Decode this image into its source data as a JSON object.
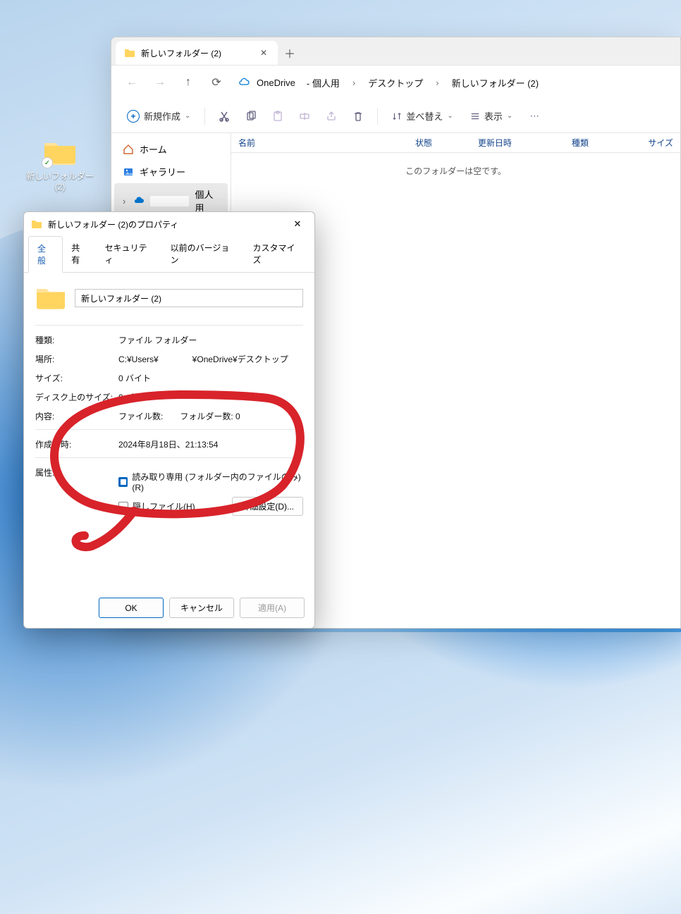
{
  "desktop": {
    "folder_label": "新しいフォルダー (2)"
  },
  "explorer": {
    "tab_title": "新しいフォルダー (2)",
    "breadcrumb": {
      "onedrive": "OneDrive",
      "personal": "- 個人用",
      "desktop": "デスクトップ",
      "current": "新しいフォルダー (2)"
    },
    "toolbar": {
      "new": "新規作成",
      "sort": "並べ替え",
      "view": "表示"
    },
    "sidebar": {
      "home": "ホーム",
      "gallery": "ギャラリー",
      "personal": "個人用"
    },
    "columns": {
      "name": "名前",
      "state": "状態",
      "date": "更新日時",
      "kind": "種類",
      "size": "サイズ"
    },
    "empty_message": "このフォルダーは空です。"
  },
  "props": {
    "title": "新しいフォルダー (2)のプロパティ",
    "tabs": {
      "general": "全般",
      "share": "共有",
      "security": "セキュリティ",
      "prev": "以前のバージョン",
      "customize": "カスタマイズ"
    },
    "name_value": "新しいフォルダー (2)",
    "rows": {
      "kind_label": "種類:",
      "kind_value": "ファイル フォルダー",
      "location_label": "場所:",
      "location_value": "C:¥Users¥　　　　¥OneDrive¥デスクトップ",
      "size_label": "サイズ:",
      "size_value": "0 バイト",
      "disk_label": "ディスク上のサイズ:",
      "disk_value": "0 バイト",
      "content_label": "内容:",
      "content_value": "ファイル数:　　フォルダー数: 0",
      "created_label": "作成日時:",
      "created_value": "2024年8月18日、21:13:54",
      "attr_label": "属性:",
      "readonly": "読み取り専用 (フォルダー内のファイルのみ)(R)",
      "hidden": "隠しファイル(H)",
      "advanced": "詳細設定(D)..."
    },
    "buttons": {
      "ok": "OK",
      "cancel": "キャンセル",
      "apply": "適用(A)"
    }
  }
}
